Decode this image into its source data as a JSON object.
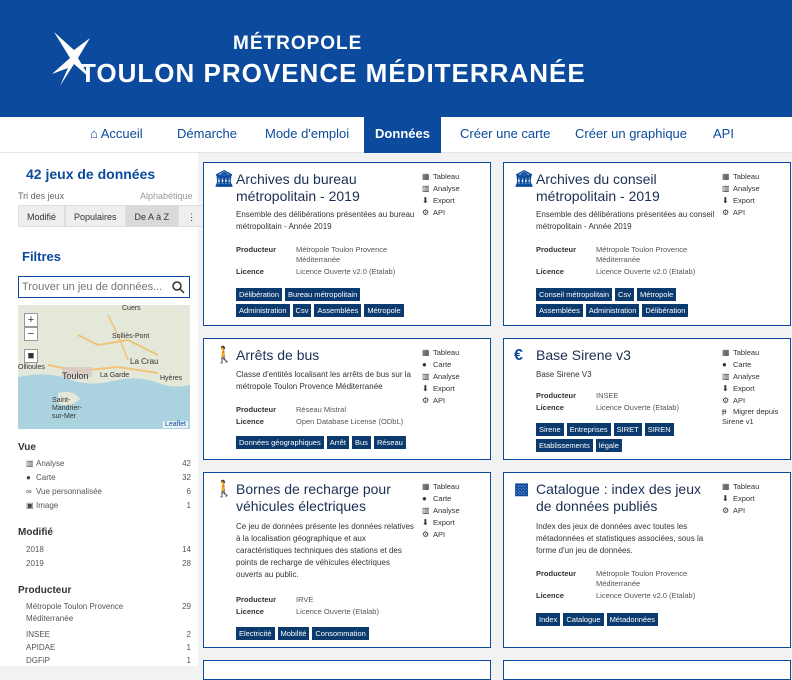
{
  "header": {
    "line1": "MÉTROPOLE",
    "line2": "TOULON PROVENCE MÉDITERRANÉE"
  },
  "nav": [
    {
      "label": "Accueil",
      "icon": "home-icon"
    },
    {
      "label": "Démarche"
    },
    {
      "label": "Mode d'emploi"
    },
    {
      "label": "Données",
      "active": true
    },
    {
      "label": "Créer une carte"
    },
    {
      "label": "Créer un graphique"
    },
    {
      "label": "API"
    }
  ],
  "sidebar": {
    "count_title": "42 jeux de données",
    "sort_label": "Tri des jeux",
    "sort_current": "Alphabétique",
    "sort_buttons": [
      "Modifié",
      "Populaires",
      "De A à Z",
      "⋮"
    ],
    "filters_title": "Filtres",
    "search_placeholder": "Trouver un jeu de données...",
    "map": {
      "labels": [
        "Cuers",
        "Solliès-Pont",
        "La Crau",
        "Ollioules",
        "Toulon",
        "La Garde",
        "Hyères",
        "Saint-Mandrier-sur-Mer"
      ],
      "attribution": "Leaflet",
      "zoom_in": "+",
      "zoom_out": "−",
      "square": "■"
    },
    "facets": [
      {
        "title": "Vue",
        "items": [
          {
            "icon": "chart-icon",
            "glyph": "▥",
            "label": "Analyse",
            "count": "42"
          },
          {
            "icon": "map-marker-icon",
            "glyph": "●",
            "label": "Carte",
            "count": "32"
          },
          {
            "icon": "binoculars-icon",
            "glyph": "∞",
            "label": "Vue personnalisée",
            "count": "6"
          },
          {
            "icon": "image-icon",
            "glyph": "▣",
            "label": "Image",
            "count": "1"
          }
        ]
      },
      {
        "title": "Modifié",
        "items": [
          {
            "label": "2018",
            "count": "14"
          },
          {
            "label": "2019",
            "count": "28"
          }
        ]
      },
      {
        "title": "Producteur",
        "items": [
          {
            "label": "Métropole Toulon Provence",
            "count": "29"
          },
          {
            "label": "Méditerranée",
            "count": ""
          },
          {
            "label": "INSEE",
            "count": "2"
          },
          {
            "label": "APIDAE",
            "count": "1"
          },
          {
            "label": "DGFiP",
            "count": "1"
          }
        ]
      }
    ]
  },
  "cards": [
    {
      "icon": "building-icon",
      "glyph": "🏛",
      "title": "Archives du bureau métropolitain - 2019",
      "desc": "Ensemble des délibérations présentées au bureau métropolitain - Année 2019",
      "producer_label": "Producteur",
      "producer": "Métropole Toulon Provence Méditerranée",
      "licence_label": "Licence",
      "licence": "Licence Ouverte v2.0 (Etalab)",
      "tags": [
        "Délibération",
        "Bureau métropolitain",
        "Administration",
        "Csv",
        "Assemblées",
        "Métropole"
      ],
      "actions": [
        {
          "icon": "table-icon",
          "glyph": "▦",
          "label": "Tableau"
        },
        {
          "icon": "chart-icon",
          "glyph": "▥",
          "label": "Analyse"
        },
        {
          "icon": "download-icon",
          "glyph": "⬇",
          "label": "Export"
        },
        {
          "icon": "cogs-icon",
          "glyph": "⚙",
          "label": "API"
        }
      ]
    },
    {
      "icon": "building-icon",
      "glyph": "🏛",
      "title": "Archives du conseil métropolitain - 2019",
      "desc": "Ensemble des délibérations présentées au conseil métropolitain - Année 2019",
      "producer_label": "Producteur",
      "producer": "Métropole Toulon Provence Méditerranée",
      "licence_label": "Licence",
      "licence": "Licence Ouverte v2.0 (Etalab)",
      "tags": [
        "Conseil métropolitain",
        "Csv",
        "Métropole",
        "Assemblées",
        "Administration",
        "Délibération"
      ],
      "actions": [
        {
          "icon": "table-icon",
          "glyph": "▦",
          "label": "Tableau"
        },
        {
          "icon": "chart-icon",
          "glyph": "▥",
          "label": "Analyse"
        },
        {
          "icon": "download-icon",
          "glyph": "⬇",
          "label": "Export"
        },
        {
          "icon": "cogs-icon",
          "glyph": "⚙",
          "label": "API"
        }
      ]
    },
    {
      "icon": "pedestrian-icon",
      "glyph": "🚶",
      "title": "Arrêts de bus",
      "desc": "Classe d'entités localisant les arrêts de bus sur la métropole Toulon Provence Méditerranée",
      "producer_label": "Producteur",
      "producer": "Réseau Mistral",
      "licence_label": "Licence",
      "licence": "Open Database License (ODbL)",
      "tags": [
        "Données géographiques",
        "Arrêt",
        "Bus",
        "Réseau"
      ],
      "actions": [
        {
          "icon": "table-icon",
          "glyph": "▦",
          "label": "Tableau"
        },
        {
          "icon": "map-marker-icon",
          "glyph": "●",
          "label": "Carte"
        },
        {
          "icon": "chart-icon",
          "glyph": "▥",
          "label": "Analyse"
        },
        {
          "icon": "download-icon",
          "glyph": "⬇",
          "label": "Export"
        },
        {
          "icon": "cogs-icon",
          "glyph": "⚙",
          "label": "API"
        }
      ]
    },
    {
      "icon": "euro-icon",
      "glyph": "€",
      "title": "Base Sirene v3",
      "desc": "Base Sirene V3",
      "producer_label": "Producteur",
      "producer": "INSEE",
      "licence_label": "Licence",
      "licence": "Licence Ouverte (Etalab)",
      "tags": [
        "Sirene",
        "Entreprises",
        "SIRET",
        "SIREN",
        "Etablissements",
        "légale"
      ],
      "actions": [
        {
          "icon": "table-icon",
          "glyph": "▦",
          "label": "Tableau"
        },
        {
          "icon": "map-marker-icon",
          "glyph": "●",
          "label": "Carte"
        },
        {
          "icon": "chart-icon",
          "glyph": "▥",
          "label": "Analyse"
        },
        {
          "icon": "download-icon",
          "glyph": "⬇",
          "label": "Export"
        },
        {
          "icon": "cogs-icon",
          "glyph": "⚙",
          "label": "API"
        },
        {
          "icon": "migrate-icon",
          "glyph": "ᵽ",
          "label": "Migrer depuis Sirene v1"
        }
      ]
    },
    {
      "icon": "pedestrian-icon",
      "glyph": "🚶",
      "title": "Bornes de recharge pour véhicules électriques",
      "desc": "Ce jeu de données présente les données relatives à la localisation géographique et aux caractéristiques techniques des stations et des points de recharge de véhicules électriques ouverts au public.",
      "producer_label": "Producteur",
      "producer": "IRVE",
      "licence_label": "Licence",
      "licence": "Licence Ouverte (Etalab)",
      "tags": [
        "Electricité",
        "Mobilité",
        "Consommation"
      ],
      "actions": [
        {
          "icon": "table-icon",
          "glyph": "▦",
          "label": "Tableau"
        },
        {
          "icon": "map-marker-icon",
          "glyph": "●",
          "label": "Carte"
        },
        {
          "icon": "chart-icon",
          "glyph": "▥",
          "label": "Analyse"
        },
        {
          "icon": "download-icon",
          "glyph": "⬇",
          "label": "Export"
        },
        {
          "icon": "cogs-icon",
          "glyph": "⚙",
          "label": "API"
        }
      ]
    },
    {
      "icon": "cubes-icon",
      "glyph": "▩",
      "title": "Catalogue : index des jeux de données publiés",
      "desc": "Index des jeux de données avec toutes les métadonnées et statistiques associées, sous la forme d'un jeu de données.",
      "producer_label": "Producteur",
      "producer": "Métropole Toulon Provence Méditerranée",
      "licence_label": "Licence",
      "licence": "Licence Ouverte v2.0 (Etalab)",
      "tags": [
        "Index",
        "Catalogue",
        "Métadonnées"
      ],
      "actions": [
        {
          "icon": "table-icon",
          "glyph": "▦",
          "label": "Tableau"
        },
        {
          "icon": "download-icon",
          "glyph": "⬇",
          "label": "Export"
        },
        {
          "icon": "cogs-icon",
          "glyph": "⚙",
          "label": "API"
        }
      ]
    }
  ],
  "colors": {
    "brand": "#0b4a9c",
    "tag": "#0b3a6e"
  }
}
